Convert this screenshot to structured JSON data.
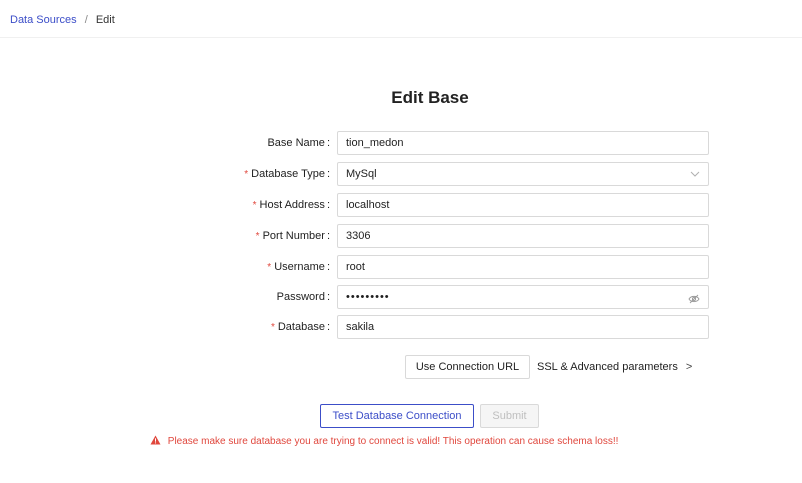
{
  "breadcrumb": {
    "parent": "Data Sources",
    "separator": "/",
    "current": "Edit"
  },
  "page": {
    "title": "Edit Base"
  },
  "form": {
    "base_name": {
      "label": "Base Name",
      "value": "tion_medon",
      "required": false
    },
    "database_type": {
      "label": "Database Type",
      "value": "MySql",
      "required": true
    },
    "host_address": {
      "label": "Host Address",
      "value": "localhost",
      "required": true
    },
    "port_number": {
      "label": "Port Number",
      "value": "3306",
      "required": true
    },
    "username": {
      "label": "Username",
      "value": "root",
      "required": true
    },
    "password": {
      "label": "Password",
      "value": "•••••••••",
      "required": false
    },
    "database": {
      "label": "Database",
      "value": "sakila",
      "required": true
    }
  },
  "actions": {
    "use_connection_url": "Use Connection URL",
    "ssl_advanced": "SSL & Advanced parameters",
    "ssl_arrow": ">",
    "test_connection": "Test Database Connection",
    "submit": "Submit"
  },
  "warning": {
    "text": "Please make sure database you are trying to connect is valid! This operation can cause schema loss!!"
  },
  "colors": {
    "accent": "#3c4ec8",
    "required": "#e0473d",
    "warning": "#e0473d"
  },
  "icons": {
    "select": "chevron-down-icon",
    "password": "eye-off-icon",
    "warning": "warning-triangle-icon"
  }
}
